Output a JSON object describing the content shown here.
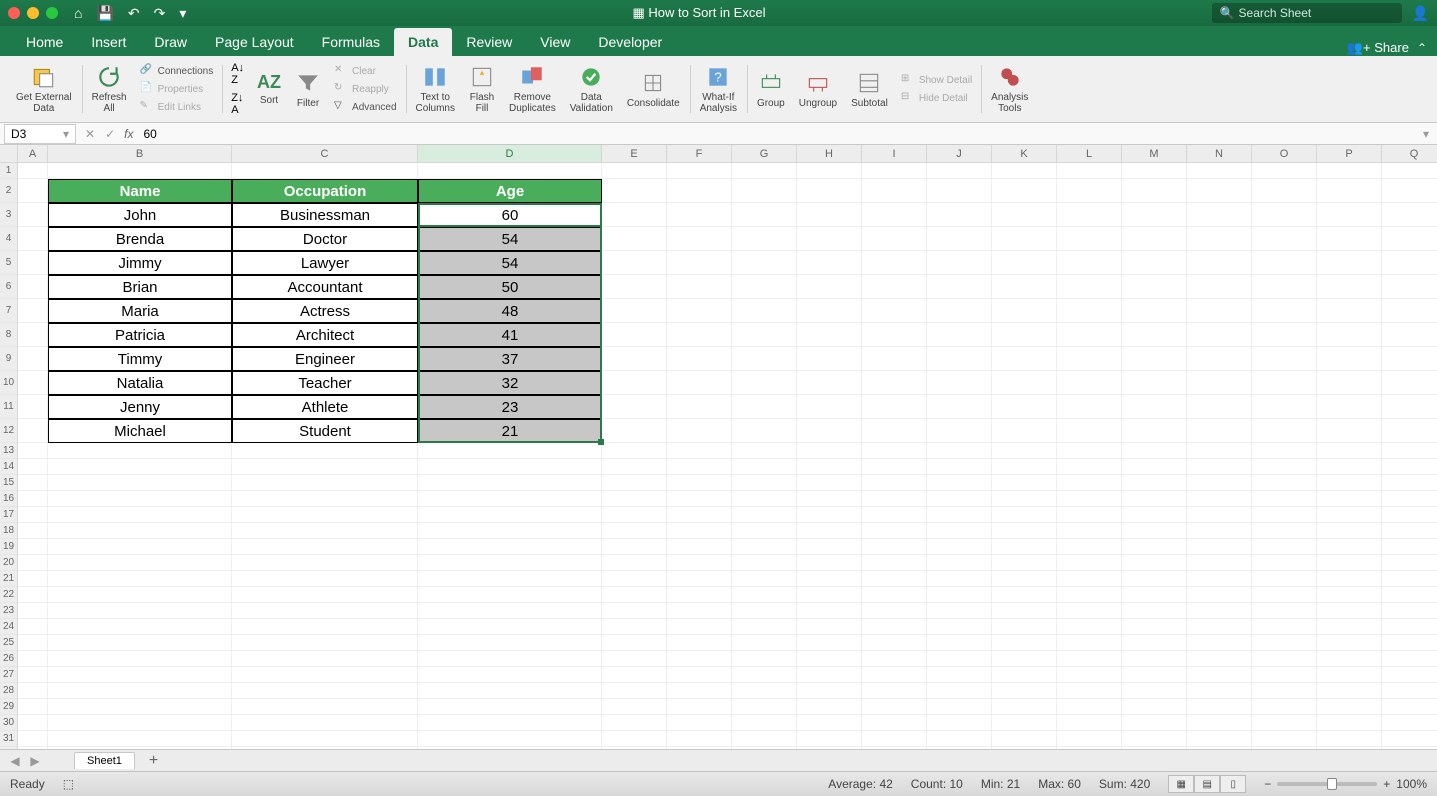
{
  "title": "How to Sort in Excel",
  "search_placeholder": "Search Sheet",
  "share": "Share",
  "tabs": [
    "Home",
    "Insert",
    "Draw",
    "Page Layout",
    "Formulas",
    "Data",
    "Review",
    "View",
    "Developer"
  ],
  "active_tab": "Data",
  "ribbon": {
    "get_external": "Get External\nData",
    "refresh": "Refresh\nAll",
    "connections": "Connections",
    "properties": "Properties",
    "edit_links": "Edit Links",
    "sort": "Sort",
    "filter": "Filter",
    "clear": "Clear",
    "reapply": "Reapply",
    "advanced": "Advanced",
    "text_columns": "Text to\nColumns",
    "flash_fill": "Flash\nFill",
    "remove_dup": "Remove\nDuplicates",
    "data_val": "Data\nValidation",
    "consolidate": "Consolidate",
    "whatif": "What-If\nAnalysis",
    "group": "Group",
    "ungroup": "Ungroup",
    "subtotal": "Subtotal",
    "show_detail": "Show Detail",
    "hide_detail": "Hide Detail",
    "analysis": "Analysis\nTools"
  },
  "namebox": "D3",
  "formula": "60",
  "columns": [
    "A",
    "B",
    "C",
    "D",
    "E",
    "F",
    "G",
    "H",
    "I",
    "J",
    "K",
    "L",
    "M",
    "N",
    "O",
    "P",
    "Q"
  ],
  "headers": [
    "Name",
    "Occupation",
    "Age"
  ],
  "rows": [
    {
      "name": "John",
      "occ": "Businessman",
      "age": "60"
    },
    {
      "name": "Brenda",
      "occ": "Doctor",
      "age": "54"
    },
    {
      "name": "Jimmy",
      "occ": "Lawyer",
      "age": "54"
    },
    {
      "name": "Brian",
      "occ": "Accountant",
      "age": "50"
    },
    {
      "name": "Maria",
      "occ": "Actress",
      "age": "48"
    },
    {
      "name": "Patricia",
      "occ": "Architect",
      "age": "41"
    },
    {
      "name": "Timmy",
      "occ": "Engineer",
      "age": "37"
    },
    {
      "name": "Natalia",
      "occ": "Teacher",
      "age": "32"
    },
    {
      "name": "Jenny",
      "occ": "Athlete",
      "age": "23"
    },
    {
      "name": "Michael",
      "occ": "Student",
      "age": "21"
    }
  ],
  "sheet_name": "Sheet1",
  "status": {
    "ready": "Ready",
    "avg": "Average: 42",
    "count": "Count: 10",
    "min": "Min: 21",
    "max": "Max: 60",
    "sum": "Sum: 420",
    "zoom": "100%"
  }
}
